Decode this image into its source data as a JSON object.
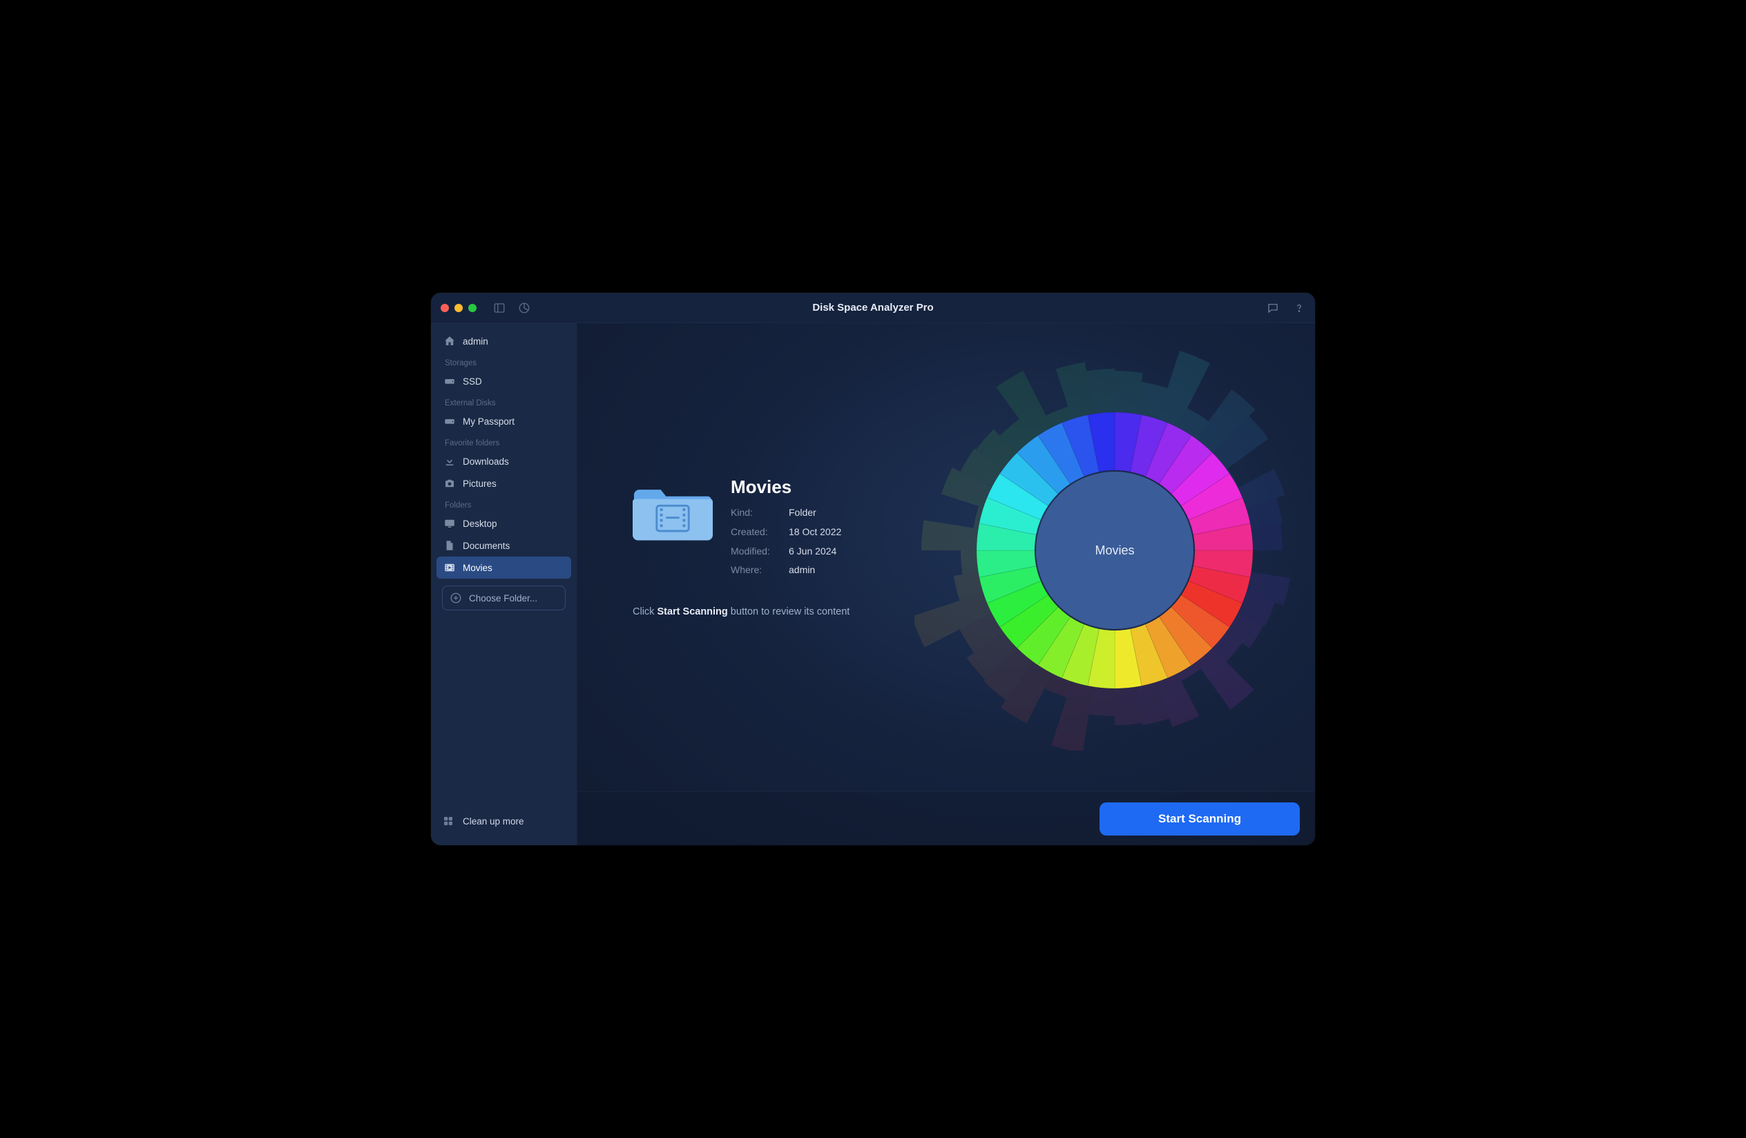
{
  "app": {
    "title": "Disk Space Analyzer Pro"
  },
  "sidebar": {
    "home": {
      "label": "admin"
    },
    "sections": [
      {
        "header": "Storages",
        "items": [
          {
            "icon": "drive",
            "label": "SSD"
          }
        ]
      },
      {
        "header": "External Disks",
        "items": [
          {
            "icon": "external-drive",
            "label": "My Passport"
          }
        ]
      },
      {
        "header": "Favorite folders",
        "items": [
          {
            "icon": "download",
            "label": "Downloads"
          },
          {
            "icon": "camera",
            "label": "Pictures"
          }
        ]
      },
      {
        "header": "Folders",
        "items": [
          {
            "icon": "monitor",
            "label": "Desktop"
          },
          {
            "icon": "document",
            "label": "Documents"
          },
          {
            "icon": "movie",
            "label": "Movies",
            "selected": true
          }
        ]
      }
    ],
    "choose_folder": "Choose Folder...",
    "footer": "Clean up more"
  },
  "details": {
    "title": "Movies",
    "rows": [
      {
        "label": "Kind:",
        "value": "Folder"
      },
      {
        "label": "Created:",
        "value": "18 Oct 2022"
      },
      {
        "label": "Modified:",
        "value": "6 Jun 2024"
      },
      {
        "label": "Where:",
        "value": "admin"
      }
    ],
    "hint_pre": "Click ",
    "hint_bold": "Start Scanning",
    "hint_post": " button to review its content"
  },
  "chart": {
    "center_label": "Movies"
  },
  "actions": {
    "primary": "Start Scanning"
  },
  "colors": {
    "accent": "#1f6af2",
    "window_bg": "#16233e",
    "sidebar_bg": "#1a2945"
  }
}
